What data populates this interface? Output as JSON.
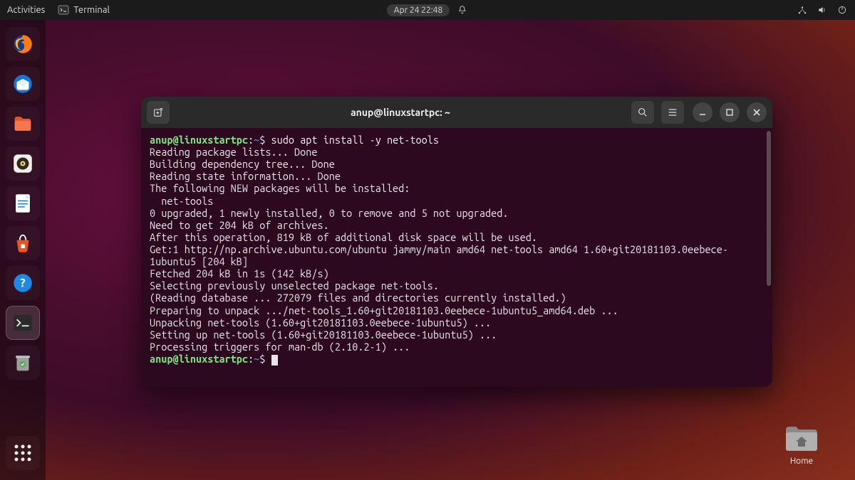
{
  "topbar": {
    "activities": "Activities",
    "app_label": "Terminal",
    "datetime": "Apr 24  22:48"
  },
  "dock": {
    "items": [
      {
        "name": "firefox"
      },
      {
        "name": "thunderbird"
      },
      {
        "name": "files"
      },
      {
        "name": "rhythmbox"
      },
      {
        "name": "libreoffice-writer"
      },
      {
        "name": "software-center"
      },
      {
        "name": "help"
      },
      {
        "name": "terminal",
        "active": true
      },
      {
        "name": "trash"
      }
    ]
  },
  "desktop": {
    "home_label": "Home"
  },
  "terminal": {
    "title": "anup@linuxstartpc: ~",
    "prompt_user": "anup@linuxstartpc",
    "prompt_sep": ":",
    "prompt_path": "~",
    "prompt_dollar": "$ ",
    "command": "sudo apt install -y net-tools",
    "lines": [
      "Reading package lists... Done",
      "Building dependency tree... Done",
      "Reading state information... Done",
      "The following NEW packages will be installed:",
      "  net-tools",
      "0 upgraded, 1 newly installed, 0 to remove and 5 not upgraded.",
      "Need to get 204 kB of archives.",
      "After this operation, 819 kB of additional disk space will be used.",
      "Get:1 http://np.archive.ubuntu.com/ubuntu jammy/main amd64 net-tools amd64 1.60+git20181103.0eebece-1ubuntu5 [204 kB]",
      "Fetched 204 kB in 1s (142 kB/s)",
      "Selecting previously unselected package net-tools.",
      "(Reading database ... 272079 files and directories currently installed.)",
      "Preparing to unpack .../net-tools_1.60+git20181103.0eebece-1ubuntu5_amd64.deb ...",
      "Unpacking net-tools (1.60+git20181103.0eebece-1ubuntu5) ...",
      "Setting up net-tools (1.60+git20181103.0eebece-1ubuntu5) ...",
      "Processing triggers for man-db (2.10.2-1) ..."
    ]
  }
}
